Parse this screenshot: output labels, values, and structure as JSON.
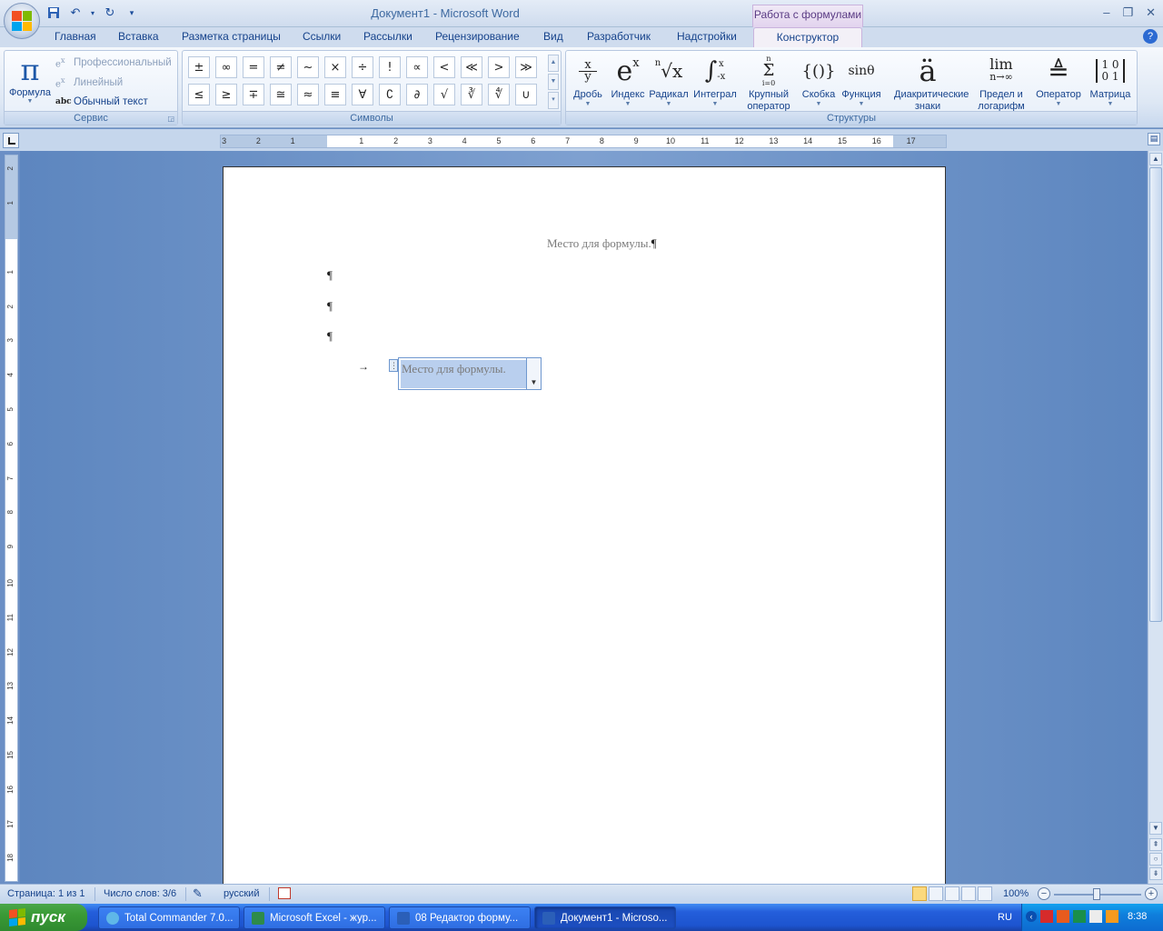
{
  "window": {
    "title": "Документ1 - Microsoft Word",
    "context_tab_title": "Работа с формулами"
  },
  "qat": {
    "save_icon": "save-icon",
    "undo_icon": "undo-icon",
    "redo_icon": "redo-icon"
  },
  "tabs": [
    {
      "label": "Главная"
    },
    {
      "label": "Вставка"
    },
    {
      "label": "Разметка страницы"
    },
    {
      "label": "Ссылки"
    },
    {
      "label": "Рассылки"
    },
    {
      "label": "Рецензирование"
    },
    {
      "label": "Вид"
    },
    {
      "label": "Разработчик"
    },
    {
      "label": "Надстройки"
    },
    {
      "label": "Конструктор"
    }
  ],
  "ribbon": {
    "service": {
      "label": "Сервис",
      "formula": "Формула",
      "professional": "Профессиональный",
      "linear": "Линейный",
      "plain_text": "Обычный текст",
      "plain_text_icon": "abc"
    },
    "symbols": {
      "label": "Символы",
      "items": [
        "±",
        "∞",
        "=",
        "≠",
        "~",
        "×",
        "÷",
        "!",
        "∝",
        "<",
        "≪",
        ">",
        "≫",
        "≤",
        "≥",
        "∓",
        "≅",
        "≈",
        "≡",
        "∀",
        "∁",
        "∂",
        "√",
        "∛",
        "∜",
        "∪"
      ]
    },
    "structures": {
      "label": "Структуры",
      "items": [
        {
          "glyph_name": "fraction-icon",
          "label": "Дробь"
        },
        {
          "glyph_name": "script-icon",
          "label": "Индекс"
        },
        {
          "glyph_name": "radical-icon",
          "label": "Радикал"
        },
        {
          "glyph_name": "integral-icon",
          "label": "Интеграл"
        },
        {
          "glyph_name": "large-operator-icon",
          "label": "Крупный оператор"
        },
        {
          "glyph_name": "bracket-icon",
          "label": "Скобка"
        },
        {
          "glyph_name": "function-icon",
          "label": "Функция"
        },
        {
          "glyph_name": "accent-icon",
          "label": "Диакритические знаки"
        },
        {
          "glyph_name": "limit-icon",
          "label": "Предел и логарифм"
        },
        {
          "glyph_name": "operator-icon",
          "label": "Оператор"
        },
        {
          "glyph_name": "matrix-icon",
          "label": "Матрица"
        }
      ],
      "glyphs": {
        "fraction_top": "x",
        "fraction_bottom": "y",
        "script_base": "e",
        "script_sup": "x",
        "radical_index": "n",
        "radical_body": "√x",
        "integral_sign": "∫",
        "integral_upper": "x",
        "integral_lower": "-x",
        "sum_top": "n",
        "sum_sign": "Σ",
        "sum_bottom": "i=0",
        "bracket": "{()}",
        "function": "sinθ",
        "accent": "ä",
        "limit_top": "lim",
        "limit_bottom": "n→∞",
        "operator": "≜",
        "matrix_row1": "1 0",
        "matrix_row2": "0 1"
      }
    }
  },
  "ruler": {
    "h_ticks": [
      "3",
      "2",
      "1",
      "1",
      "2",
      "3",
      "4",
      "5",
      "6",
      "7",
      "8",
      "9",
      "10",
      "11",
      "12",
      "13",
      "14",
      "15",
      "16",
      "17"
    ],
    "v_ticks": [
      "2",
      "1",
      "1",
      "2",
      "3",
      "4",
      "5",
      "6",
      "7",
      "8",
      "9",
      "10",
      "11",
      "12",
      "13",
      "14",
      "15",
      "16",
      "17",
      "18"
    ]
  },
  "document": {
    "line1": "Место для формулы.",
    "pilcrow": "¶",
    "tab_arrow": "→",
    "eq_placeholder": "Место для формулы.",
    "eq_handle": "⋮",
    "eq_dropdown": "▼"
  },
  "statusbar": {
    "page": "Страница: 1 из 1",
    "words": "Число слов: 3/6",
    "language": "русский",
    "zoom": "100%",
    "zoom_minus": "−",
    "zoom_plus": "+"
  },
  "taskbar": {
    "start": "пуск",
    "tasks": [
      {
        "label": "Total Commander 7.0..."
      },
      {
        "label": "Microsoft Excel - жур..."
      },
      {
        "label": "08 Редактор форму..."
      },
      {
        "label": "Документ1 - Microso..."
      }
    ],
    "lang": "RU",
    "time": "8:38"
  }
}
